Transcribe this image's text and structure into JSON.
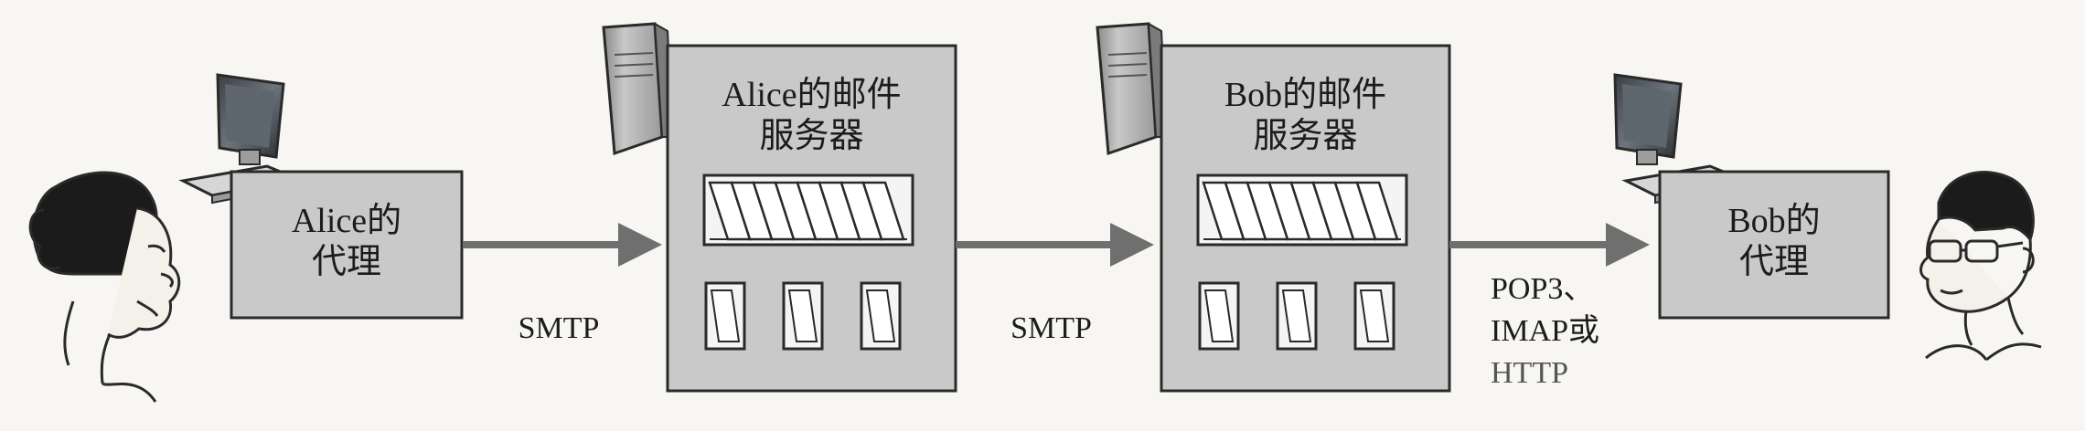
{
  "alice_agent": {
    "line1": "Alice的",
    "line2": "代理"
  },
  "alice_server": {
    "line1": "Alice的邮件",
    "line2": "服务器"
  },
  "bob_server": {
    "line1": "Bob的邮件",
    "line2": "服务器"
  },
  "bob_agent": {
    "line1": "Bob的",
    "line2": "代理"
  },
  "protocols": {
    "agent_to_server": "SMTP",
    "server_to_server": "SMTP",
    "server_to_agent": [
      "POP3、",
      "IMAP或",
      "HTTP"
    ]
  },
  "colors": {
    "box_fill": "#c9c9c9",
    "box_stroke": "#2a2a2a",
    "arrow": "#6f6f6f",
    "background": "#f7f6f2"
  },
  "icons": [
    "person-alice-icon",
    "computer-icon",
    "server-tower-icon",
    "message-queue-icon",
    "mailbox-icon",
    "person-bob-icon"
  ]
}
